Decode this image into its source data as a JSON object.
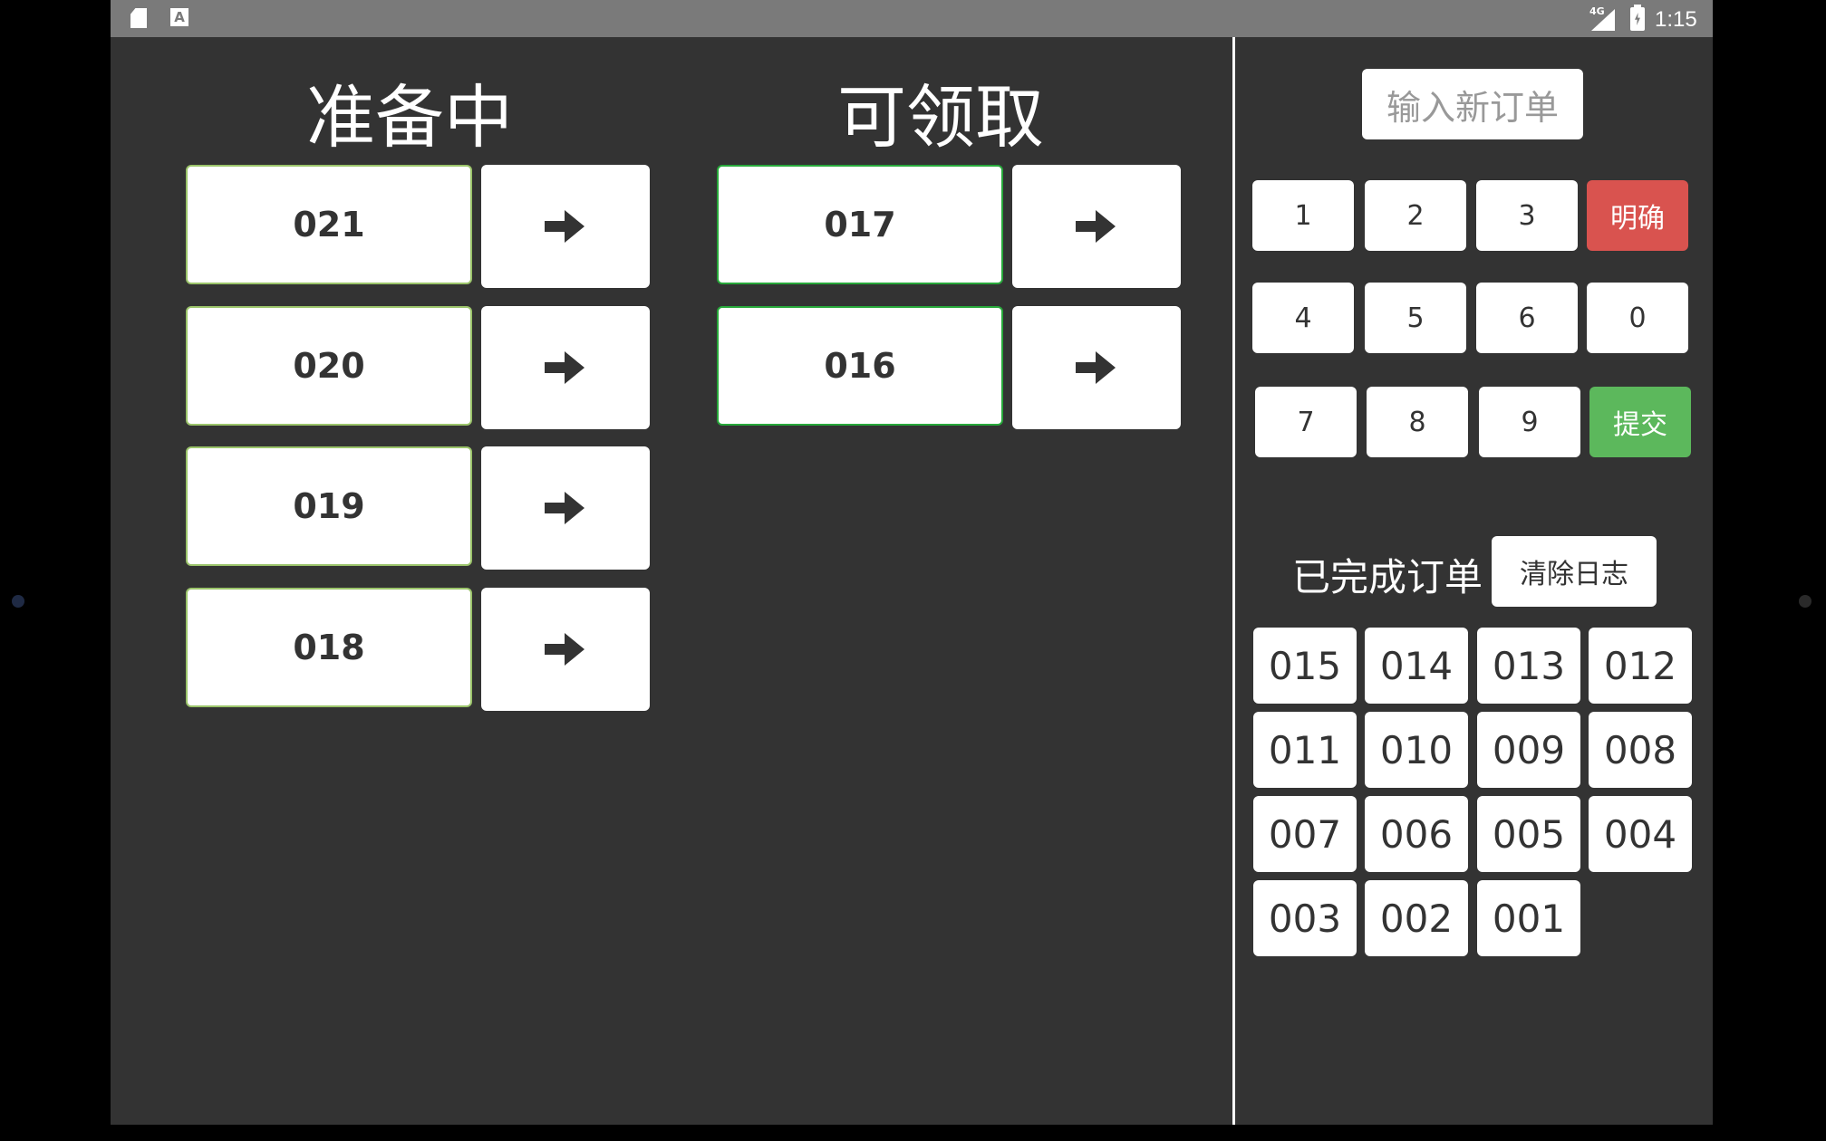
{
  "status_bar": {
    "network": "4G",
    "time": "1:15",
    "sd_icon": "sd-card-icon",
    "notification_icon": "A"
  },
  "preparing": {
    "title": "准备中",
    "orders": [
      "021",
      "020",
      "019",
      "018"
    ]
  },
  "ready": {
    "title": "可领取",
    "orders": [
      "017",
      "016"
    ]
  },
  "entry": {
    "input_label": "输入新订单",
    "keys": [
      "1",
      "2",
      "3",
      "明确",
      "4",
      "5",
      "6",
      "0",
      "7",
      "8",
      "9",
      "提交"
    ],
    "clear_color": "#d9534f",
    "submit_color": "#5cb85c"
  },
  "completed": {
    "title": "已完成订单",
    "clear_log_label": "清除日志",
    "orders": [
      "015",
      "014",
      "013",
      "012",
      "011",
      "010",
      "009",
      "008",
      "007",
      "006",
      "005",
      "004",
      "003",
      "002",
      "001"
    ]
  }
}
